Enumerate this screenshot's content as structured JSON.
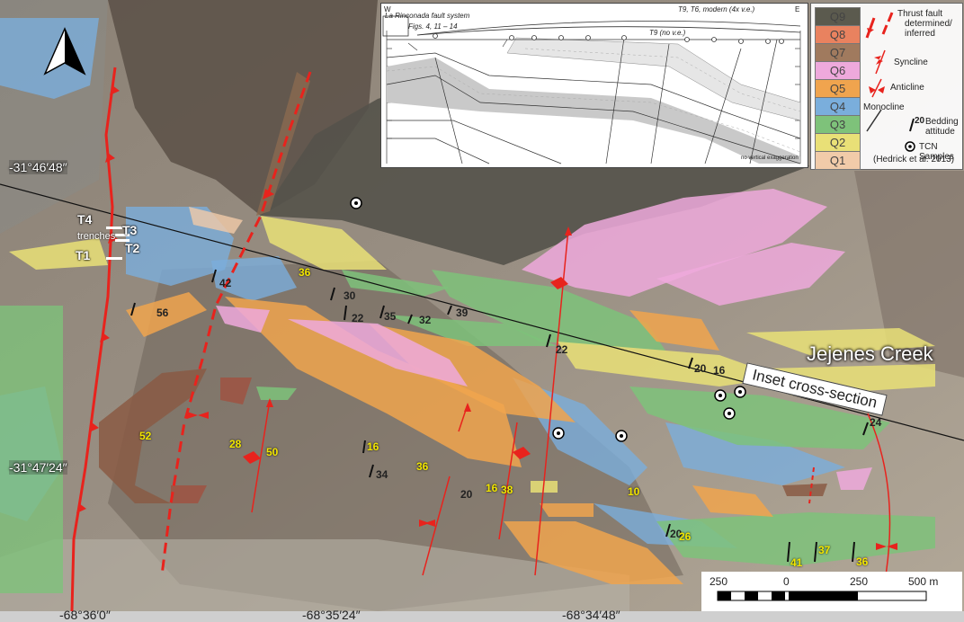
{
  "coordinates": {
    "lat_top": "-31°46′48″",
    "lat_bottom": "-31°47′24″",
    "lon_left": "-68°36′0″",
    "lon_mid": "-68°35′24″",
    "lon_right": "-68°34′48″"
  },
  "labels": {
    "creek": "Jejenes Creek",
    "inset_tag": "Inset cross-section",
    "trenches": "trenches",
    "T1": "T1",
    "T2": "T2",
    "T3": "T3",
    "T4": "T4"
  },
  "bedding_attitudes_black": [
    "56",
    "42",
    "30",
    "22",
    "35",
    "32",
    "39",
    "22",
    "20",
    "16",
    "24",
    "34",
    "20",
    "20"
  ],
  "bedding_attitudes_yellow": [
    "36",
    "52",
    "28",
    "50",
    "16",
    "36",
    "16",
    "38",
    "10",
    "26",
    "41",
    "37",
    "36"
  ],
  "inset": {
    "left_end": "W",
    "right_end": "E",
    "fault_system": "La Rinconada fault system",
    "figs": "Figs. 4, 11 – 14",
    "modern": "T9, T6, modern (4x v.e.)",
    "no_ve": "T9 (no v.e.)",
    "no_vertical": "no vertical exaggeration"
  },
  "legend": {
    "units": [
      {
        "label": "Q9",
        "color": "#5b5a4e"
      },
      {
        "label": "Q8",
        "color": "#e9825f"
      },
      {
        "label": "Q7",
        "color": "#a07a5e"
      },
      {
        "label": "Q6",
        "color": "#eea9dc"
      },
      {
        "label": "Q5",
        "color": "#f0a44e"
      },
      {
        "label": "Q4",
        "color": "#7aaedc"
      },
      {
        "label": "Q3",
        "color": "#7ec27a"
      },
      {
        "label": "Q2",
        "color": "#e9e077"
      },
      {
        "label": "Q1",
        "color": "#f1cba9"
      }
    ],
    "thrust": "Thrust fault",
    "thrust2": "determined/",
    "thrust3": "inferred",
    "syncline": "Syncline",
    "anticline": "Anticline",
    "monocline": "Monocline",
    "bedding_num": "20",
    "bedding": "Bedding",
    "bedding2": "attitude",
    "tcn": "TCN Samples",
    "tcn2": "(Hedrick et al. 2013)"
  },
  "scale": {
    "l250": "250",
    "l0": "0",
    "r250": "250",
    "l500": "500 m"
  }
}
